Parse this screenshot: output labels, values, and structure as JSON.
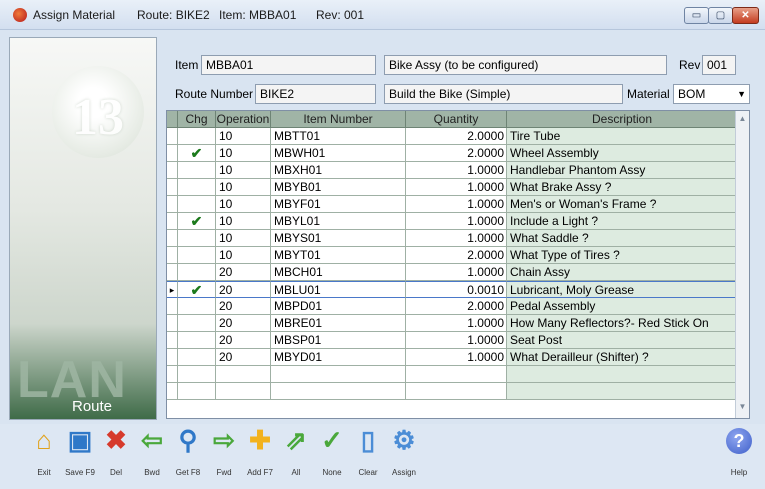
{
  "window": {
    "app_title": "Assign Material",
    "route_caption": "Route: BIKE2",
    "item_caption": "Item: MBBA01",
    "rev_caption": "Rev: 001",
    "minimize_glyph": "▭",
    "maximize_glyph": "▢",
    "close_glyph": "✕"
  },
  "left_panel": {
    "logo_text": "13",
    "watermark_text": "LAN",
    "route_label": "Route"
  },
  "header": {
    "item_label": "Item",
    "item_value": "MBBA01",
    "item_description": "Bike Assy (to be configured)",
    "rev_label": "Rev",
    "rev_value": "001",
    "route_number_label": "Route Number",
    "route_number_value": "BIKE2",
    "route_description": "Build the Bike (Simple)",
    "material_label": "Material",
    "material_value": "BOM"
  },
  "grid": {
    "columns": [
      "Chg",
      "Operation",
      "Item Number",
      "Quantity",
      "Description"
    ],
    "check_glyph": "✔",
    "current_row_glyph": "▸",
    "rows": [
      {
        "chg": "",
        "operation": "10",
        "item": "MBTT01",
        "qty": "2.0000",
        "desc": "Tire Tube"
      },
      {
        "chg": "✔",
        "operation": "10",
        "item": "MBWH01",
        "qty": "2.0000",
        "desc": "Wheel Assembly"
      },
      {
        "chg": "",
        "operation": "10",
        "item": "MBXH01",
        "qty": "1.0000",
        "desc": "Handlebar Phantom Assy"
      },
      {
        "chg": "",
        "operation": "10",
        "item": "MBYB01",
        "qty": "1.0000",
        "desc": "What Brake Assy ?"
      },
      {
        "chg": "",
        "operation": "10",
        "item": "MBYF01",
        "qty": "1.0000",
        "desc": "Men's or Woman's Frame ?"
      },
      {
        "chg": "✔",
        "operation": "10",
        "item": "MBYL01",
        "qty": "1.0000",
        "desc": "Include a Light ?"
      },
      {
        "chg": "",
        "operation": "10",
        "item": "MBYS01",
        "qty": "1.0000",
        "desc": "What Saddle ?"
      },
      {
        "chg": "",
        "operation": "10",
        "item": "MBYT01",
        "qty": "2.0000",
        "desc": "What Type of Tires ?"
      },
      {
        "chg": "",
        "operation": "20",
        "item": "MBCH01",
        "qty": "1.0000",
        "desc": "Chain Assy"
      },
      {
        "chg": "✔",
        "operation": "20",
        "item": "MBLU01",
        "qty": "0.0010",
        "desc": "Lubricant, Moly Grease",
        "current": true
      },
      {
        "chg": "",
        "operation": "20",
        "item": "MBPD01",
        "qty": "2.0000",
        "desc": "Pedal Assembly"
      },
      {
        "chg": "",
        "operation": "20",
        "item": "MBRE01",
        "qty": "1.0000",
        "desc": "How Many Reflectors?- Red Stick On"
      },
      {
        "chg": "",
        "operation": "20",
        "item": "MBSP01",
        "qty": "1.0000",
        "desc": "Seat Post"
      },
      {
        "chg": "",
        "operation": "20",
        "item": "MBYD01",
        "qty": "1.0000",
        "desc": "What Derailleur (Shifter) ?"
      },
      {
        "chg": "",
        "operation": "",
        "item": "",
        "qty": "",
        "desc": ""
      },
      {
        "chg": "",
        "operation": "",
        "item": "",
        "qty": "",
        "desc": ""
      }
    ]
  },
  "toolbar": {
    "buttons": [
      {
        "label": "Exit",
        "icon": "home-icon",
        "glyph": "⌂",
        "color": "#e0a21b"
      },
      {
        "label": "Save F9",
        "icon": "floppy-disk-icon",
        "glyph": "▣",
        "color": "#2f78c8"
      },
      {
        "label": "Del",
        "icon": "delete-x-icon",
        "glyph": "✖",
        "color": "#d63a2c"
      },
      {
        "label": "Bwd",
        "icon": "arrow-left-icon",
        "glyph": "⇦",
        "color": "#4aa83b"
      },
      {
        "label": "Get F8",
        "icon": "magnifier-icon",
        "glyph": "⚲",
        "color": "#2f78c8"
      },
      {
        "label": "Fwd",
        "icon": "arrow-right-icon",
        "glyph": "⇨",
        "color": "#4aa83b"
      },
      {
        "label": "Add F7",
        "icon": "plus-icon",
        "glyph": "✚",
        "color": "#f2b21d"
      },
      {
        "label": "All",
        "icon": "check-all-icon",
        "glyph": "⇗",
        "color": "#4aa83b"
      },
      {
        "label": "None",
        "icon": "check-none-icon",
        "glyph": "✓",
        "color": "#4aa83b"
      },
      {
        "label": "Clear",
        "icon": "clear-page-icon",
        "glyph": "▯",
        "color": "#4b8dd6"
      },
      {
        "label": "Assign",
        "icon": "assign-gear-icon",
        "glyph": "⚙",
        "color": "#4b8dd6"
      }
    ],
    "help": {
      "label": "Help",
      "icon": "help-icon",
      "glyph": "?",
      "color": "#3e5fc9"
    }
  },
  "scrollbar": {
    "up_glyph": "▲",
    "down_glyph": "▼"
  }
}
